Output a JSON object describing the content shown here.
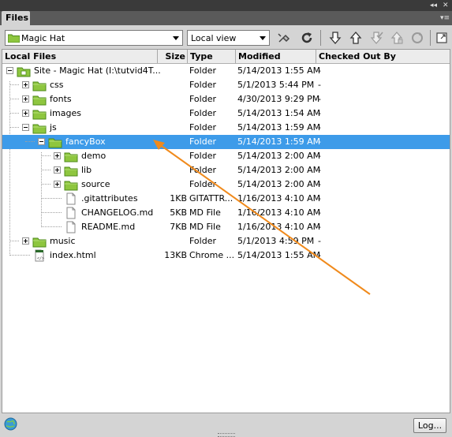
{
  "panel": {
    "tab_label": "Files"
  },
  "toolbar": {
    "site_select": "Magic Hat",
    "view_select": "Local view",
    "buttons": [
      "connect-icon",
      "refresh-icon",
      "get-icon",
      "put-icon",
      "checkout-icon",
      "checkin-icon",
      "sync-icon",
      "expand-icon"
    ]
  },
  "columns": {
    "local_files": "Local Files",
    "size": "Size",
    "type": "Type",
    "modified": "Modified",
    "checked_out_by": "Checked Out By"
  },
  "rows": [
    {
      "name": "Site - Magic Hat (I:\\tutvid4T...",
      "size": "",
      "type": "Folder",
      "modified": "5/14/2013 1:55 AM",
      "checked": "-",
      "icon": "site-folder-icon"
    },
    {
      "name": "css",
      "size": "",
      "type": "Folder",
      "modified": "5/1/2013 5:44 PM",
      "checked": "-",
      "icon": "folder-icon"
    },
    {
      "name": "fonts",
      "size": "",
      "type": "Folder",
      "modified": "4/30/2013 9:29 PM",
      "checked": "-",
      "icon": "folder-icon"
    },
    {
      "name": "images",
      "size": "",
      "type": "Folder",
      "modified": "5/14/2013 1:54 AM",
      "checked": "-",
      "icon": "folder-icon"
    },
    {
      "name": "js",
      "size": "",
      "type": "Folder",
      "modified": "5/14/2013 1:59 AM",
      "checked": "-",
      "icon": "folder-icon"
    },
    {
      "name": "fancyBox",
      "size": "",
      "type": "Folder",
      "modified": "5/14/2013 1:59 AM",
      "checked": "-",
      "icon": "folder-icon"
    },
    {
      "name": "demo",
      "size": "",
      "type": "Folder",
      "modified": "5/14/2013 2:00 AM",
      "checked": "-",
      "icon": "folder-icon"
    },
    {
      "name": "lib",
      "size": "",
      "type": "Folder",
      "modified": "5/14/2013 2:00 AM",
      "checked": "-",
      "icon": "folder-icon"
    },
    {
      "name": "source",
      "size": "",
      "type": "Folder",
      "modified": "5/14/2013 2:00 AM",
      "checked": "-",
      "icon": "folder-icon"
    },
    {
      "name": ".gitattributes",
      "size": "1KB",
      "type": "GITATTR...",
      "modified": "1/16/2013 4:10 AM",
      "checked": "-",
      "icon": "file-icon"
    },
    {
      "name": "CHANGELOG.md",
      "size": "5KB",
      "type": "MD File",
      "modified": "1/16/2013 4:10 AM",
      "checked": "-",
      "icon": "file-icon"
    },
    {
      "name": "README.md",
      "size": "7KB",
      "type": "MD File",
      "modified": "1/16/2013 4:10 AM",
      "checked": "-",
      "icon": "file-icon"
    },
    {
      "name": "music",
      "size": "",
      "type": "Folder",
      "modified": "5/1/2013 4:59 PM",
      "checked": "-",
      "icon": "folder-icon"
    },
    {
      "name": "index.html",
      "size": "13KB",
      "type": "Chrome ...",
      "modified": "5/14/2013 1:55 AM",
      "checked": "-",
      "icon": "html-file-icon"
    }
  ],
  "annotation": {
    "color": "#f08a1c"
  },
  "colors": {
    "selection": "#3d9be9",
    "folder": "#8ec63f"
  },
  "statusbar": {
    "log_button": "Log..."
  }
}
